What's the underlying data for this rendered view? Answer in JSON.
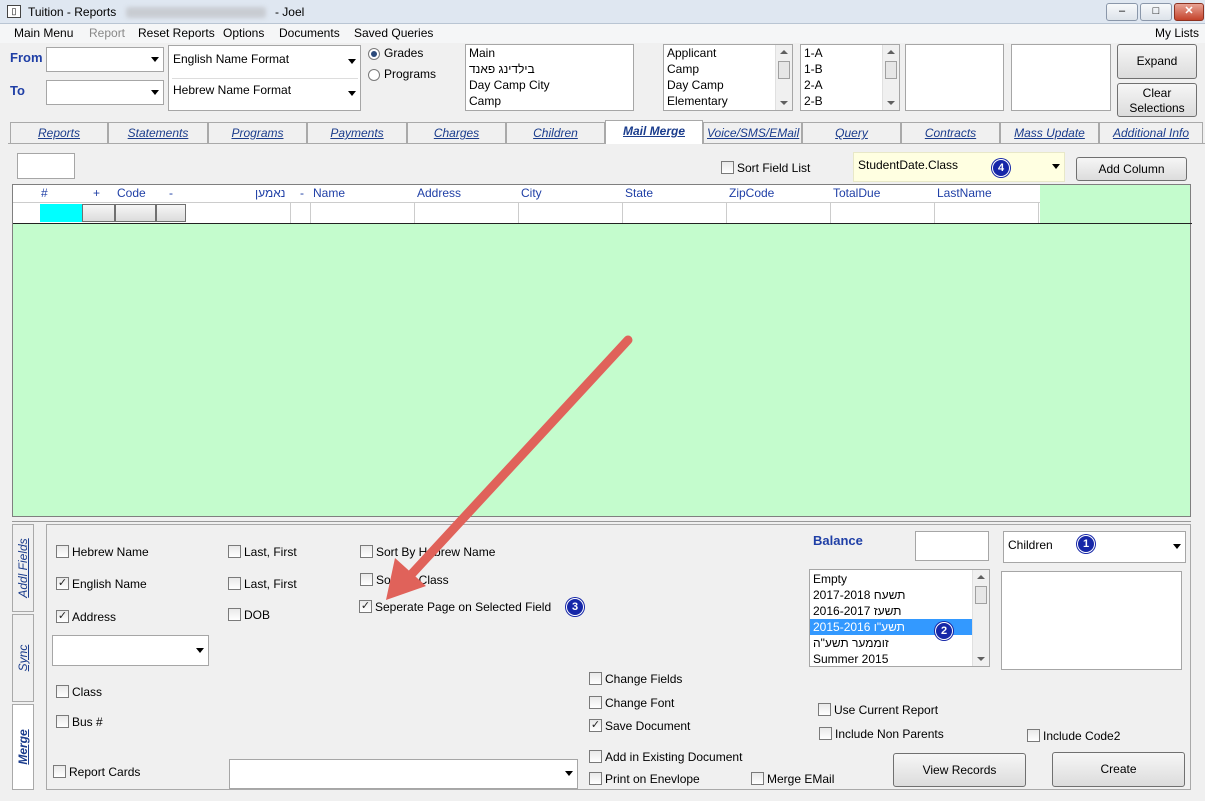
{
  "window": {
    "title_left": "Tuition - Reports",
    "title_right": "- Joel",
    "buttons": {
      "minimize": "–",
      "maximize": "□",
      "close": "✕"
    }
  },
  "menu": {
    "items": [
      "Main Menu",
      "Report",
      "Reset Reports",
      "Options",
      "Documents",
      "Saved Queries"
    ],
    "right": "My Lists"
  },
  "filters": {
    "from_label": "From",
    "to_label": "To",
    "english_format": "English Name Format",
    "hebrew_format": "Hebrew Name Format",
    "radio_grades": "Grades",
    "radio_programs": "Programs",
    "programs_list": [
      "Main",
      "בילדינג פאנד",
      "Day Camp City",
      "Camp"
    ],
    "types_list": [
      "Applicant",
      "Camp",
      "Day Camp",
      "Elementary"
    ],
    "classes_list": [
      "1-A",
      "1-B",
      "2-A",
      "2-B"
    ],
    "expand_button": "Expand",
    "clear_button_line1": "Clear",
    "clear_button_line2": "Selections"
  },
  "tabs": [
    "Reports",
    "Statements",
    "Programs",
    "Payments",
    "Charges",
    "Children",
    "Mail Merge",
    "Voice/SMS/EMail",
    "Query",
    "Contracts",
    "Mass Update",
    "Additional Info"
  ],
  "active_tab": "Mail Merge",
  "toolbar": {
    "sort_field_list": "Sort Field List",
    "field_combo": "StudentDate.Class",
    "add_column": "Add Column"
  },
  "grid": {
    "headers": {
      "num": "#",
      "plus": "+",
      "code": "Code",
      "minus": "-",
      "nickname": "נאמען",
      "dash": "-",
      "name": "Name",
      "address": "Address",
      "city": "City",
      "state": "State",
      "zip": "ZipCode",
      "totaldue": "TotalDue",
      "lastname": "LastName"
    }
  },
  "side_tabs": [
    "Addl Fields",
    "Sync",
    "Merge"
  ],
  "options": {
    "hebrew_name": "Hebrew Name",
    "english_name": "English Name",
    "address": "Address",
    "last_first_1": "Last, First",
    "last_first_2": "Last, First",
    "dob": "DOB",
    "sort_by_hebrew": "Sort By Hebrew Name",
    "sort_by_class": "Sort By Class",
    "separate_page": "Seperate Page on Selected Field",
    "class": "Class",
    "bus": "Bus #",
    "report_cards": "Report Cards",
    "change_fields": "Change Fields",
    "change_font": "Change Font",
    "save_document": "Save Document",
    "add_existing": "Add in Existing Document",
    "print_envelope": "Print on Enevlope",
    "merge_email": "Merge EMail",
    "balance_label": "Balance",
    "children_combo": "Children",
    "years_list": [
      "Empty",
      "2017-2018 תשעח",
      "2016-2017 תשעז",
      "2015-2016 תשע\"ו",
      "זוממער תשע\"ה",
      "Summer 2015"
    ],
    "selected_year_index": 3,
    "use_current_report": "Use Current Report",
    "include_non_parents": "Include Non Parents",
    "include_code2": "Include Code2",
    "view_records": "View Records",
    "create": "Create"
  },
  "badges": [
    "1",
    "2",
    "3",
    "4"
  ],
  "colors": {
    "grid_bg": "#c4fccd",
    "link_blue": "#1a3c8c",
    "badge": "#1627a8",
    "arrow": "#e0625a"
  }
}
